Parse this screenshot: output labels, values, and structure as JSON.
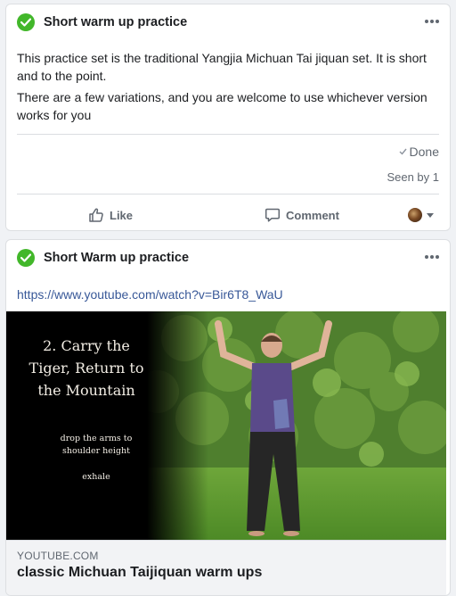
{
  "post1": {
    "title": "Short warm up practice",
    "paragraphs": [
      "This practice set is the traditional Yangjia Michuan Tai jiquan set. It is short and to the point.",
      "There are a few variations, and you are welcome to use whichever version works for you"
    ],
    "done_label": "Done",
    "seen_label": "Seen by 1",
    "like_label": "Like",
    "comment_label": "Comment"
  },
  "post2": {
    "title": "Short Warm up practice",
    "link": "https://www.youtube.com/watch?v=Bir6T8_WaU",
    "video": {
      "overlay_title": "2. Carry the Tiger, Return to the Mountain",
      "overlay_subtitle": "drop the arms to shoulder height",
      "overlay_breath": "exhale"
    },
    "domain": "YOUTUBE.COM",
    "video_title": "classic Michuan Taijiquan warm ups"
  },
  "colors": {
    "accent_green": "#42b72a",
    "link_blue": "#385898",
    "background": "#f0f2f5"
  },
  "icons": [
    "check-circle-icon",
    "more-icon",
    "checkmark-icon",
    "thumbs-up-icon",
    "comment-icon",
    "chevron-down-icon"
  ]
}
